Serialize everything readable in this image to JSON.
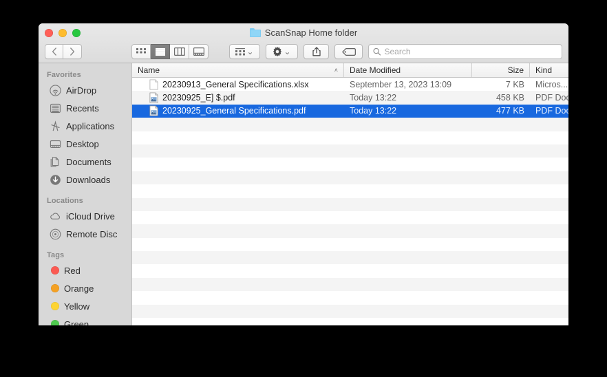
{
  "window": {
    "title": "ScanSnap Home folder",
    "title_icon": "folder-icon",
    "traffic_lights": [
      {
        "name": "close-button",
        "color": "#ff5f57"
      },
      {
        "name": "minimize-button",
        "color": "#febc2e"
      },
      {
        "name": "zoom-button",
        "color": "#28c840"
      }
    ]
  },
  "toolbar": {
    "back_label": "‹",
    "forward_label": "›",
    "view_modes": [
      {
        "name": "icon-view-button",
        "active": false
      },
      {
        "name": "list-view-button",
        "active": true
      },
      {
        "name": "column-view-button",
        "active": false
      },
      {
        "name": "gallery-view-button",
        "active": false
      }
    ],
    "arrange_label": "arrange-icon",
    "action_label": "gear-icon",
    "share_label": "share-icon",
    "tag_label": "tag-icon",
    "chevron": "⌄"
  },
  "search": {
    "placeholder": "Search",
    "value": "",
    "icon": "search-icon"
  },
  "sidebar": {
    "sections": [
      {
        "header": "Favorites",
        "items": [
          {
            "label": "AirDrop",
            "icon": "airdrop-icon"
          },
          {
            "label": "Recents",
            "icon": "recents-icon"
          },
          {
            "label": "Applications",
            "icon": "applications-icon"
          },
          {
            "label": "Desktop",
            "icon": "desktop-icon"
          },
          {
            "label": "Documents",
            "icon": "documents-icon"
          },
          {
            "label": "Downloads",
            "icon": "downloads-icon"
          }
        ]
      },
      {
        "header": "Locations",
        "items": [
          {
            "label": "iCloud Drive",
            "icon": "icloud-icon"
          },
          {
            "label": "Remote Disc",
            "icon": "disc-icon"
          }
        ]
      },
      {
        "header": "Tags",
        "items": [
          {
            "label": "Red",
            "icon": "tag-dot-icon",
            "color": "#fb5a52"
          },
          {
            "label": "Orange",
            "icon": "tag-dot-icon",
            "color": "#f4a124"
          },
          {
            "label": "Yellow",
            "icon": "tag-dot-icon",
            "color": "#fdd433"
          },
          {
            "label": "Green",
            "icon": "tag-dot-icon",
            "color": "#4ec94e"
          }
        ]
      }
    ]
  },
  "filelist": {
    "columns": [
      {
        "label": "Name",
        "sorted": true,
        "sort_arrow": "˄"
      },
      {
        "label": "Date Modified"
      },
      {
        "label": "Size"
      },
      {
        "label": "Kind"
      }
    ],
    "rows": [
      {
        "name": "20230913_General Specifications.xlsx",
        "date": "September 13, 2023 13:09",
        "size": "7 KB",
        "kind": "Micros...",
        "icon": "generic-document-icon",
        "selected": false
      },
      {
        "name": "20230925_E] $.pdf",
        "date": "Today 13:22",
        "size": "458 KB",
        "kind": "PDF Doc",
        "icon": "pdf-document-icon",
        "selected": false
      },
      {
        "name": "20230925_General Specifications.pdf",
        "date": "Today 13:22",
        "size": "477 KB",
        "kind": "PDF Doc",
        "icon": "pdf-document-icon",
        "selected": true
      }
    ],
    "empty_row_count": 16
  },
  "colors": {
    "selection": "#1868df",
    "sidebar_bg": "#d8d8d8",
    "stripe": "#f4f4f4"
  }
}
